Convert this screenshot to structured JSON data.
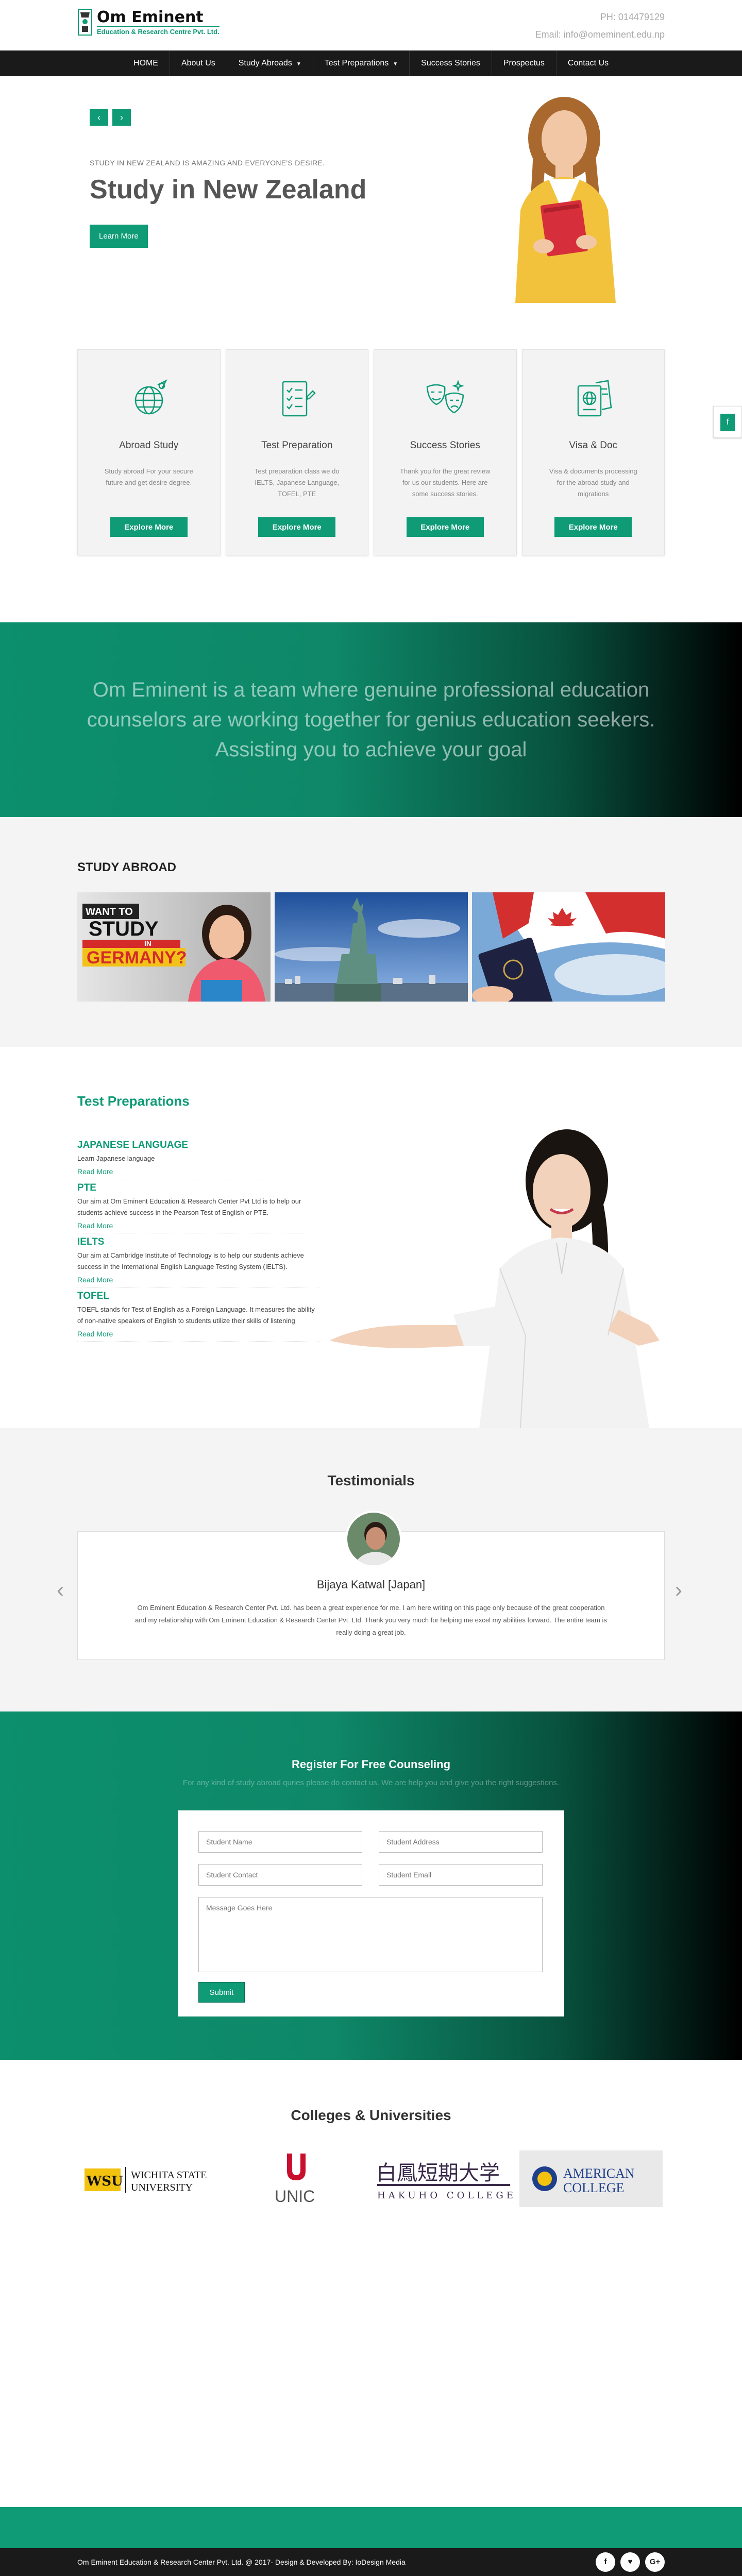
{
  "header": {
    "logo_title": "Om Eminent",
    "logo_subtitle": "Education & Research Centre Pvt. Ltd.",
    "phone": "PH: 014479129",
    "email": "Email: info@omeminent.edu.np"
  },
  "nav": {
    "items": [
      "HOME",
      "About Us",
      "Study Abroads",
      "Test Preparations",
      "Success Stories",
      "Prospectus",
      "Contact Us"
    ],
    "dropdown_caret": "▼"
  },
  "hero": {
    "prev": "‹",
    "next": "›",
    "kicker": "STUDY IN NEW ZEALAND IS AMAZING AND EVERYONE'S DESIRE.",
    "title": "Study in New Zealand",
    "button": "Learn More"
  },
  "services": [
    {
      "title": "Abroad Study",
      "text": "Study abroad For your secure future and get desire degree.",
      "button": "Explore More",
      "icon": "globe-icon"
    },
    {
      "title": "Test Preparation",
      "text": "Test preparation class we do IELTS, Japanese Language, TOFEL, PTE",
      "button": "Explore More",
      "icon": "checklist-icon"
    },
    {
      "title": "Success Stories",
      "text": "Thank you for the great review for us our students. Here are some success stories.",
      "button": "Explore More",
      "icon": "masks-icon"
    },
    {
      "title": "Visa & Doc",
      "text": "Visa & documents processing for the abroad study and migrations",
      "button": "Explore More",
      "icon": "passport-icon"
    }
  ],
  "side_tab": "f",
  "banner": {
    "text": "Om Eminent is a team where genuine professional education counselors are working together for genius education seekers. Assisting you to achieve your goal"
  },
  "study_abroad": {
    "heading": "STUDY ABROAD",
    "card1_line1": "WANT TO",
    "card1_line2": "STUDY",
    "card1_line3": "IN",
    "card1_line4": "GERMANY?"
  },
  "tests": {
    "heading": "Test Preparations",
    "items": [
      {
        "name": "JAPANESE LANGUAGE",
        "desc": "Learn Japanese language",
        "more": "Read More"
      },
      {
        "name": "PTE",
        "desc": "Our aim at Om Eminent Education & Research Center Pvt Ltd is to help our students achieve success in the Pearson Test of English or PTE.",
        "more": "Read More"
      },
      {
        "name": "IELTS",
        "desc": "Our aim at Cambridge Institute of Technology is to help our students achieve success in the International English Language Testing System (IELTS).",
        "more": "Read More"
      },
      {
        "name": "TOFEL",
        "desc": "TOEFL stands for Test of English as a Foreign Language. It measures the ability of non-native speakers of English to students utilize their skills of listening",
        "more": "Read More"
      }
    ]
  },
  "testimonials": {
    "heading": "Testimonials",
    "name": "Bijaya Katwal [Japan]",
    "text": "Om Eminent Education & Research Center Pvt. Ltd. has been a great experience for me. I am here writing on this page only because of the great cooperation and my relationship with Om Eminent Education & Research Center Pvt. Ltd. Thank you very much for helping me excel my abilities forward. The entire team is really doing a great job.",
    "prev": "‹",
    "next": "›"
  },
  "register": {
    "heading": "Register For Free Counseling",
    "subheading": "For any kind of study abroad quries please do contact us. We are help you and give you the right suggestions.",
    "name_ph": "Student Name",
    "address_ph": "Student Address",
    "contact_ph": "Student Contact",
    "email_ph": "Student Email",
    "message_ph": "Message Goes Here",
    "submit": "Submit"
  },
  "colleges": {
    "heading": "Colleges & Universities",
    "wichita_line1": "WICHITA STATE",
    "wichita_line2": "UNIVERSITY",
    "wichita_mark": "WSU",
    "unic": "UNIC",
    "hakuho_jp": "白鳳短期大学",
    "hakuho_en": "HAKUHO COLLEGE",
    "american_line1": "AMERICAN",
    "american_line2": "COLLEGE"
  },
  "footer": {
    "copy": "Om Eminent Education & Research Center Pvt. Ltd. @ 2017- Design & Developed By: IoDesign Media",
    "socials": [
      "f",
      "♥",
      "G+"
    ]
  },
  "colors": {
    "accent": "#0e9b76",
    "dark": "#1a1a1a"
  }
}
